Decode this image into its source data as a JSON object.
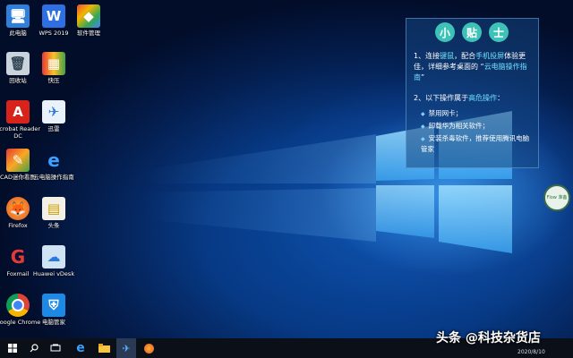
{
  "desktop": {
    "icons": [
      {
        "label": "此电脑"
      },
      {
        "label": "WPS 2019"
      },
      {
        "label": "软件管理"
      },
      {
        "label": "回收站"
      },
      {
        "label": "快压"
      },
      {
        "label": "Acrobat Reader DC"
      },
      {
        "label": "迅雷"
      },
      {
        "label": "CAD迷你看图"
      },
      {
        "label": "云电脑操作指南"
      },
      {
        "label": "Firefox"
      },
      {
        "label": "头条"
      },
      {
        "label": "Foxmail"
      },
      {
        "label": "Huawei vDesk"
      },
      {
        "label": "Google Chrome"
      },
      {
        "label": "电脑管家"
      }
    ]
  },
  "tips": {
    "title_chars": [
      "小",
      "贴",
      "士"
    ],
    "p1_a": "1、连接",
    "p1_hl1": "键鼠",
    "p1_b": "，配合",
    "p1_hl2": "手机投屏",
    "p1_c": "体验更佳，详细参考桌面的 “",
    "p1_hl3": "云电脑操作指南",
    "p1_d": "”",
    "p2_a": "2、以下操作属于",
    "p2_hl": "高危操作",
    "p2_b": "：",
    "bullets": [
      "禁用网卡；",
      "卸载华为相关软件；",
      "安装杀毒软件，推荐使用腾讯电脑管家"
    ]
  },
  "widget": {
    "text": "Flow 准备"
  },
  "taskbar": {
    "date": "2020/8/10",
    "icons": [
      "windows-start-icon",
      "search-icon",
      "task-view-icon",
      "edge-icon",
      "file-explorer-icon",
      "xunlei-icon",
      "firefox-icon"
    ]
  },
  "watermark": {
    "text": "头条 @科技杂货店"
  }
}
